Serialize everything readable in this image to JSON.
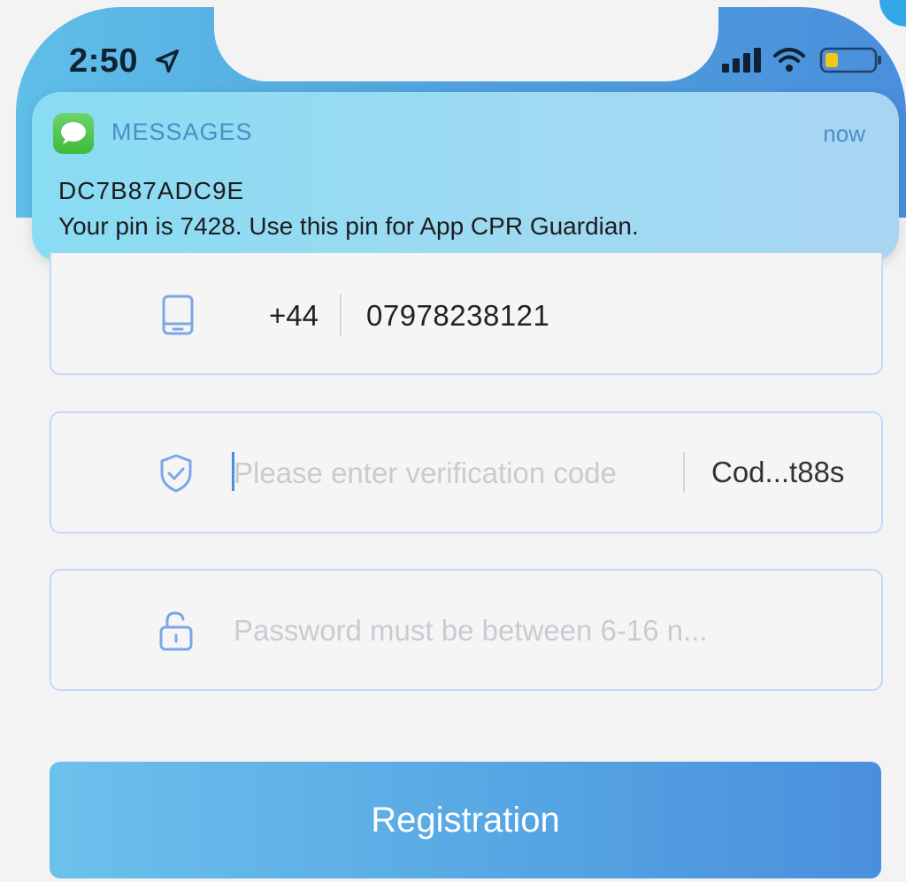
{
  "status_bar": {
    "time": "2:50",
    "location_icon": "location-arrow-icon",
    "signal_icon": "cellular-signal-icon",
    "wifi_icon": "wifi-icon",
    "battery_icon": "battery-low-icon"
  },
  "notification": {
    "app_icon": "messages-icon",
    "app_name": "MESSAGES",
    "time": "now",
    "title": "DC7B87ADC9E",
    "body": "Your pin is 7428. Use this pin for App CPR Guardian."
  },
  "form": {
    "phone": {
      "icon": "phone-icon",
      "country_code": "+44",
      "value": "07978238121"
    },
    "verification": {
      "icon": "shield-check-icon",
      "placeholder": "Please enter verification code",
      "code_button": "Cod...t88s"
    },
    "password": {
      "icon": "unlock-icon",
      "placeholder": "Password must be between 6-16 n..."
    },
    "submit_label": "Registration"
  },
  "colors": {
    "accent": "#4a8fdc",
    "accent_light": "#6cc1ec",
    "field_border": "#c6d8f5",
    "placeholder": "#c9cbd0"
  }
}
